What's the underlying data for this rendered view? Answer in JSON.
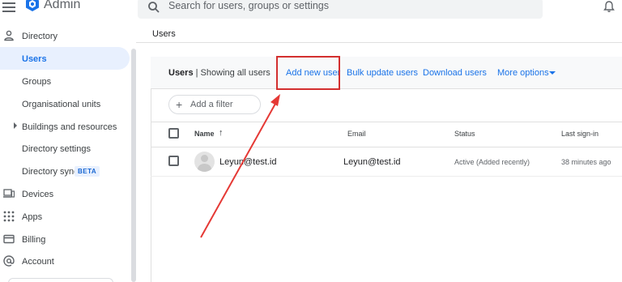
{
  "app": {
    "brand": "Admin"
  },
  "search": {
    "placeholder": "Search for users, groups or settings"
  },
  "sidebar": {
    "items": [
      {
        "label": "Directory",
        "icon": "person-icon"
      },
      {
        "label": "Users",
        "active": true
      },
      {
        "label": "Groups"
      },
      {
        "label": "Organisational units"
      },
      {
        "label": "Buildings and resources"
      },
      {
        "label": "Directory settings"
      },
      {
        "label": "Directory sync"
      },
      {
        "label": "Devices",
        "icon": "devices-icon"
      },
      {
        "label": "Apps",
        "icon": "apps-grid-icon"
      },
      {
        "label": "Billing",
        "icon": "credit-card-icon"
      },
      {
        "label": "Account",
        "icon": "at-sign-icon"
      }
    ],
    "beta_badge": "BETA"
  },
  "breadcrumb": "Users",
  "toolbar": {
    "title_bold": "Users",
    "title_rest": "| Showing all users",
    "add_new_user": "Add new user",
    "bulk_update": "Bulk update users",
    "download": "Download users",
    "more_options": "More options"
  },
  "filter": {
    "label": "Add a filter"
  },
  "table": {
    "headers": {
      "name": "Name",
      "email": "Email",
      "status": "Status",
      "last_sign_in": "Last sign-in"
    },
    "rows": [
      {
        "name": "Leyun@test.id",
        "email": "Leyun@test.id",
        "status": "Active (Added recently)",
        "last_sign_in": "38 minutes ago"
      }
    ]
  },
  "colors": {
    "accent": "#1a73e8",
    "highlight": "#d32f2f",
    "active_bg": "#e8f0fe"
  }
}
